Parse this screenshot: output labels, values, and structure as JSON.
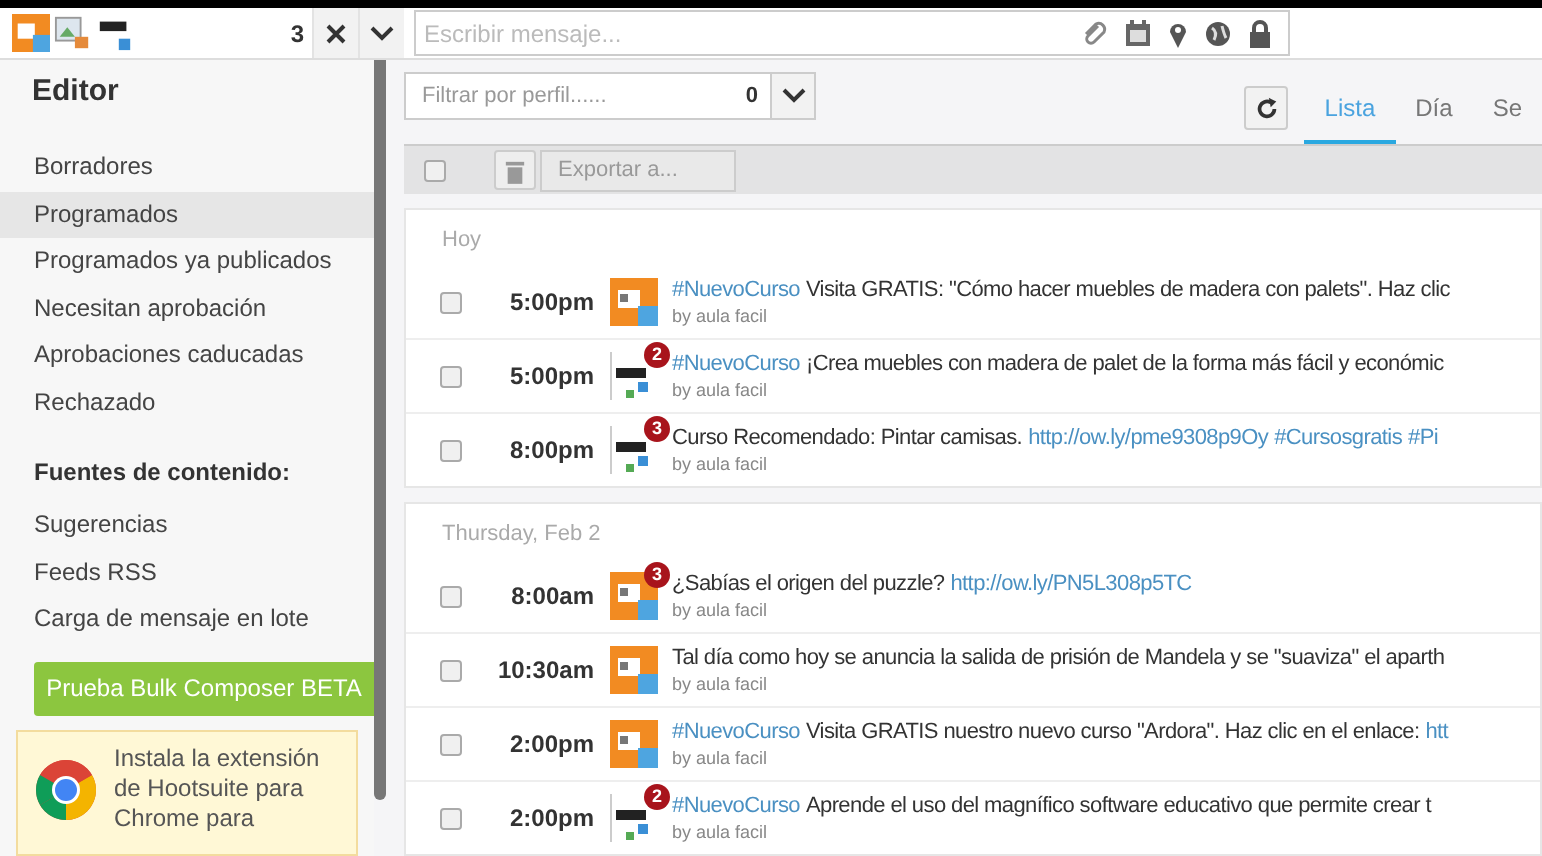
{
  "composer": {
    "avatars": [
      {
        "kind": "twitter-thumb"
      },
      {
        "kind": "broken-image"
      },
      {
        "kind": "logo-thumb"
      }
    ],
    "count": "3",
    "placeholder": "Escribir mensaje..."
  },
  "sidebar": {
    "title": "Editor",
    "items": [
      {
        "label": "Borradores",
        "selected": false
      },
      {
        "label": "Programados",
        "selected": true
      },
      {
        "label": "Programados ya publicados",
        "selected": false
      },
      {
        "label": "Necesitan aprobación",
        "selected": false
      },
      {
        "label": "Aprobaciones caducadas",
        "selected": false
      },
      {
        "label": "Rechazado",
        "selected": false
      }
    ],
    "sources_heading": "Fuentes de contenido:",
    "sources": [
      "Sugerencias",
      "Feeds RSS",
      "Carga de mensaje en lote"
    ],
    "cta_button": "Prueba Bulk Composer BETA",
    "promo": "Instala la extensión de Hootsuite para Chrome para"
  },
  "filter": {
    "placeholder": "Filtrar por perfil......",
    "count": "0"
  },
  "view_tabs": [
    {
      "label": "Lista",
      "selected": true
    },
    {
      "label": "Día",
      "selected": false
    },
    {
      "label": "Se",
      "selected": false
    }
  ],
  "toolbar": {
    "select_all": {
      "checked": false
    },
    "export_placeholder": "Exportar a..."
  },
  "groups": [
    {
      "label": "Hoy",
      "rows": [
        {
          "checked": false,
          "time": "5:00pm",
          "avatar": {
            "kind": "twitter-thumb"
          },
          "parts": [
            {
              "kind": "hashtag",
              "text": "#NuevoCurso"
            },
            {
              "kind": "text",
              "text": "Visita GRATIS: \"Cómo hacer muebles de madera con palets\". Haz clic"
            }
          ],
          "byline": "by aula facil"
        },
        {
          "checked": false,
          "time": "5:00pm",
          "avatar": {
            "kind": "logo-thumb",
            "badge": "2"
          },
          "parts": [
            {
              "kind": "hashtag",
              "text": "#NuevoCurso"
            },
            {
              "kind": "text",
              "text": "¡Crea muebles con madera de palet de la forma más fácil y económic"
            }
          ],
          "byline": "by aula facil"
        },
        {
          "checked": false,
          "time": "8:00pm",
          "avatar": {
            "kind": "logo-thumb",
            "badge": "3"
          },
          "parts": [
            {
              "kind": "text",
              "text": "Curso Recomendado: Pintar camisas."
            },
            {
              "kind": "link",
              "text": "http://ow.ly/pme9308p9Oy"
            },
            {
              "kind": "hashtag",
              "text": "#Cursosgratis"
            },
            {
              "kind": "hashtag",
              "text": "#Pi"
            }
          ],
          "byline": "by aula facil"
        }
      ]
    },
    {
      "label": "Thursday, Feb 2",
      "rows": [
        {
          "checked": false,
          "time": "8:00am",
          "avatar": {
            "kind": "twitter-thumb",
            "badge": "3"
          },
          "parts": [
            {
              "kind": "text",
              "text": "¿Sabías el origen del puzzle?"
            },
            {
              "kind": "link",
              "text": "http://ow.ly/PN5L308p5TC"
            }
          ],
          "byline": "by aula facil"
        },
        {
          "checked": false,
          "time": "10:30am",
          "avatar": {
            "kind": "twitter-thumb"
          },
          "parts": [
            {
              "kind": "text",
              "text": "Tal día como hoy se anuncia la salida de prisión de Mandela y se \"suaviza\" el aparth"
            }
          ],
          "byline": "by aula facil"
        },
        {
          "checked": false,
          "time": "2:00pm",
          "avatar": {
            "kind": "twitter-thumb"
          },
          "parts": [
            {
              "kind": "hashtag",
              "text": "#NuevoCurso"
            },
            {
              "kind": "text",
              "text": "Visita GRATIS nuestro nuevo curso \"Ardora\". Haz clic en el enlace:"
            },
            {
              "kind": "link",
              "text": "htt"
            }
          ],
          "byline": "by aula facil"
        },
        {
          "checked": false,
          "time": "2:00pm",
          "avatar": {
            "kind": "logo-thumb",
            "badge": "2"
          },
          "parts": [
            {
              "kind": "hashtag",
              "text": "#NuevoCurso"
            },
            {
              "kind": "text",
              "text": "Aprende el uso del magnífico software educativo que permite crear t"
            }
          ],
          "byline": "by aula facil"
        }
      ]
    }
  ]
}
